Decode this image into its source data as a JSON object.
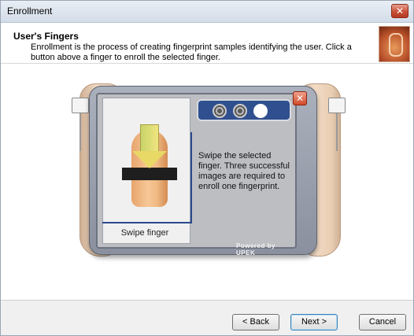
{
  "window": {
    "title": "Enrollment",
    "close_glyph": "✕"
  },
  "header": {
    "title": "User's Fingers",
    "description": "Enrollment is the process of creating fingerprint samples identifying the user. Click a button above a finger to enroll the selected finger."
  },
  "device": {
    "instruction": "Swipe the selected finger. Three successful images are required to enroll one fingerprint.",
    "swipe_label": "Swipe finger",
    "powered_by": "Powered by UPEK",
    "close_glyph": "✕",
    "progress": {
      "captured": 2,
      "required": 3
    }
  },
  "buttons": {
    "back": "< Back",
    "next": "Next >",
    "cancel": "Cancel"
  },
  "colors": {
    "accent": "#2f4f8f",
    "close": "#c9503a"
  },
  "icons": [
    "close-icon",
    "fingerprint-icon",
    "swipe-arrow-icon",
    "hand-icon"
  ]
}
